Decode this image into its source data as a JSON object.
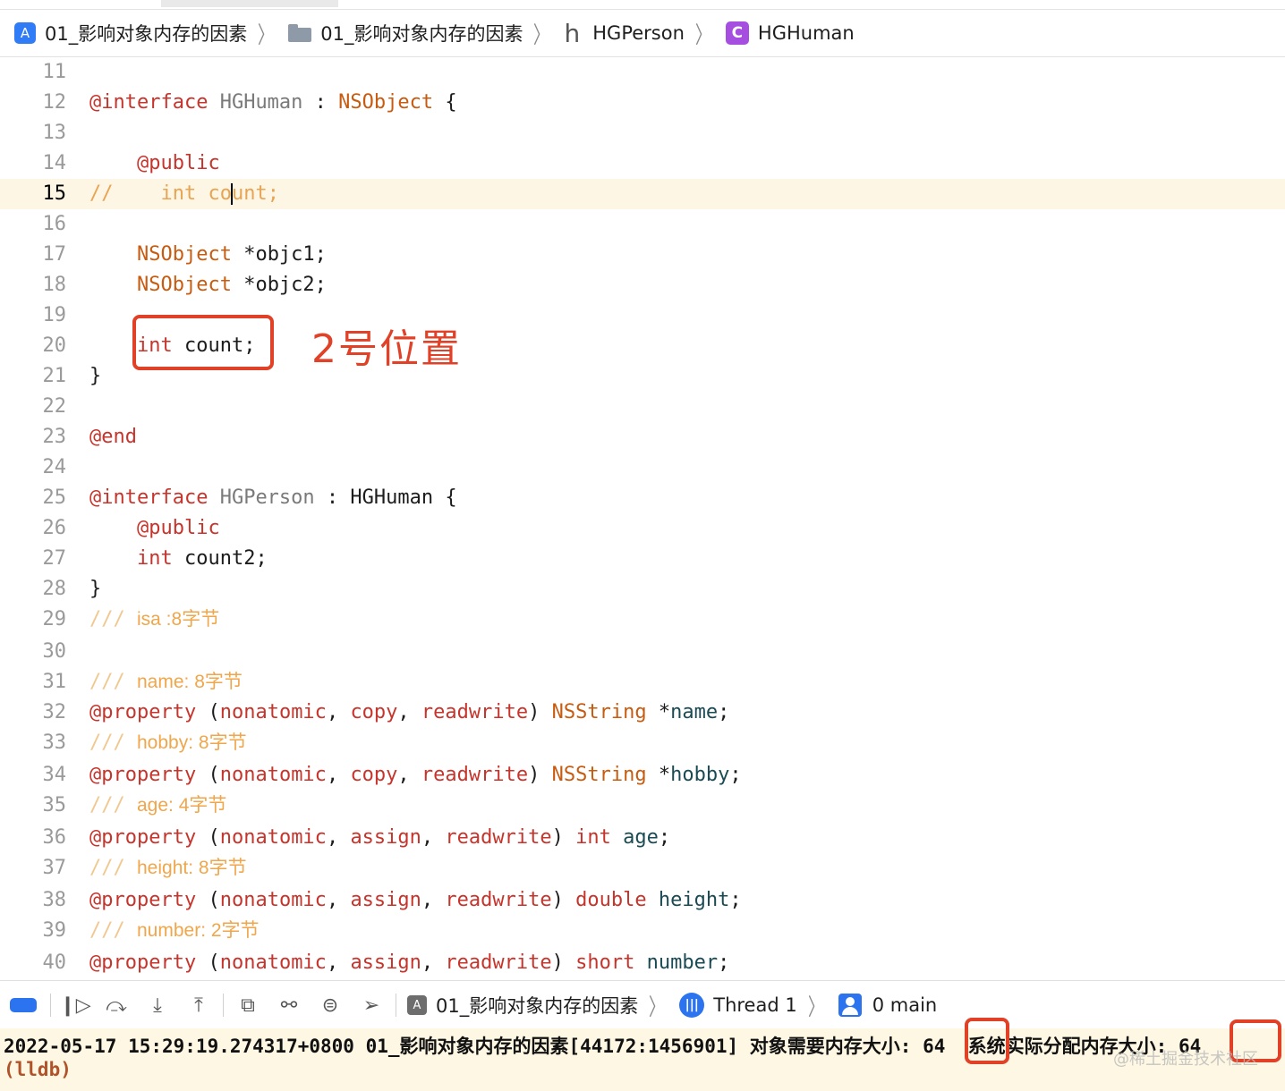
{
  "breadcrumb": [
    {
      "icon": "app-icon",
      "label": "01_影响对象内存的因素"
    },
    {
      "icon": "folder-icon",
      "label": "01_影响对象内存的因素"
    },
    {
      "icon": "header-file-icon",
      "glyph": "h",
      "label": "HGPerson"
    },
    {
      "icon": "class-icon",
      "glyph": "C",
      "label": "HGHuman"
    }
  ],
  "lines": [
    {
      "n": "11",
      "html": ""
    },
    {
      "n": "12",
      "html": "<span class='kw'>@interface</span> <span class='cls'>HGHuman</span> : <span class='ty'>NSObject</span> {"
    },
    {
      "n": "13",
      "html": ""
    },
    {
      "n": "14",
      "html": "    <span class='kw'>@public</span>"
    },
    {
      "n": "15",
      "html": "<span class='cm'>//    int co<i class='caret'></i>unt;</span>",
      "hl": true
    },
    {
      "n": "16",
      "html": ""
    },
    {
      "n": "17",
      "html": "    <span class='ty'>NSObject</span> *objc1;"
    },
    {
      "n": "18",
      "html": "    <span class='ty'>NSObject</span> *objc2;"
    },
    {
      "n": "19",
      "html": ""
    },
    {
      "n": "20",
      "html": "    <span class='kw'>int</span> count;"
    },
    {
      "n": "21",
      "html": "}"
    },
    {
      "n": "22",
      "html": ""
    },
    {
      "n": "23",
      "html": "<span class='kw'>@end</span>"
    },
    {
      "n": "24",
      "html": ""
    },
    {
      "n": "25",
      "html": "<span class='kw'>@interface</span> <span class='cls'>HGPerson</span> : HGHuman {"
    },
    {
      "n": "26",
      "html": "    <span class='kw'>@public</span>"
    },
    {
      "n": "27",
      "html": "    <span class='kw'>int</span> count2;"
    },
    {
      "n": "28",
      "html": "}"
    },
    {
      "n": "29",
      "html": "<span class='docslash'>///</span> <span class='doc'>isa :8字节</span>"
    },
    {
      "n": "30",
      "html": ""
    },
    {
      "n": "31",
      "html": "<span class='docslash'>///</span> <span class='doc'>name: 8字节</span>"
    },
    {
      "n": "32",
      "html": "<span class='kw'>@property</span> (<span class='kw'>nonatomic</span>, <span class='kw'>copy</span>, <span class='kw'>readwrite</span>) <span class='ty'>NSString</span> *<span class='id'>name</span>;"
    },
    {
      "n": "33",
      "html": "<span class='docslash'>///</span> <span class='doc'>hobby: 8字节</span>"
    },
    {
      "n": "34",
      "html": "<span class='kw'>@property</span> (<span class='kw'>nonatomic</span>, <span class='kw'>copy</span>, <span class='kw'>readwrite</span>) <span class='ty'>NSString</span> *<span class='id'>hobby</span>;"
    },
    {
      "n": "35",
      "html": "<span class='docslash'>///</span> <span class='doc'>age: 4字节</span>"
    },
    {
      "n": "36",
      "html": "<span class='kw'>@property</span> (<span class='kw'>nonatomic</span>, <span class='kw'>assign</span>, <span class='kw'>readwrite</span>) <span class='kw'>int</span> <span class='id'>age</span>;"
    },
    {
      "n": "37",
      "html": "<span class='docslash'>///</span> <span class='doc'>height: 8字节</span>"
    },
    {
      "n": "38",
      "html": "<span class='kw'>@property</span> (<span class='kw'>nonatomic</span>, <span class='kw'>assign</span>, <span class='kw'>readwrite</span>) <span class='kw'>double</span> <span class='id'>height</span>;"
    },
    {
      "n": "39",
      "html": "<span class='docslash'>///</span> <span class='doc'>number: 2字节</span>"
    },
    {
      "n": "40",
      "html": "<span class='kw'>@property</span> (<span class='kw'>nonatomic</span>, <span class='kw'>assign</span>, <span class='kw'>readwrite</span>) <span class='kw'>short</span> <span class='id'>number</span>;"
    }
  ],
  "annotation": "2号位置",
  "debug": {
    "target_label": "01_影响对象内存的因素",
    "thread_label": "Thread 1",
    "frame_label": "0 main"
  },
  "console": {
    "log_prefix": "2022-05-17 15:29:19.274317+0800 01_影响对象内存的因素[44172:1456901] 对象需要内存大小: ",
    "needed": "64",
    "mid": "  系统实际分配内存大小: ",
    "allocated": "64",
    "prompt": "(lldb)"
  },
  "watermark": "@稀土掘金技术社区",
  "colors": {
    "keyword": "#c7342c",
    "type": "#c75b10",
    "comment": "#e8a453",
    "highlight": "#fdf6e4",
    "annotation": "#e04127",
    "accent": "#2c73f0"
  }
}
